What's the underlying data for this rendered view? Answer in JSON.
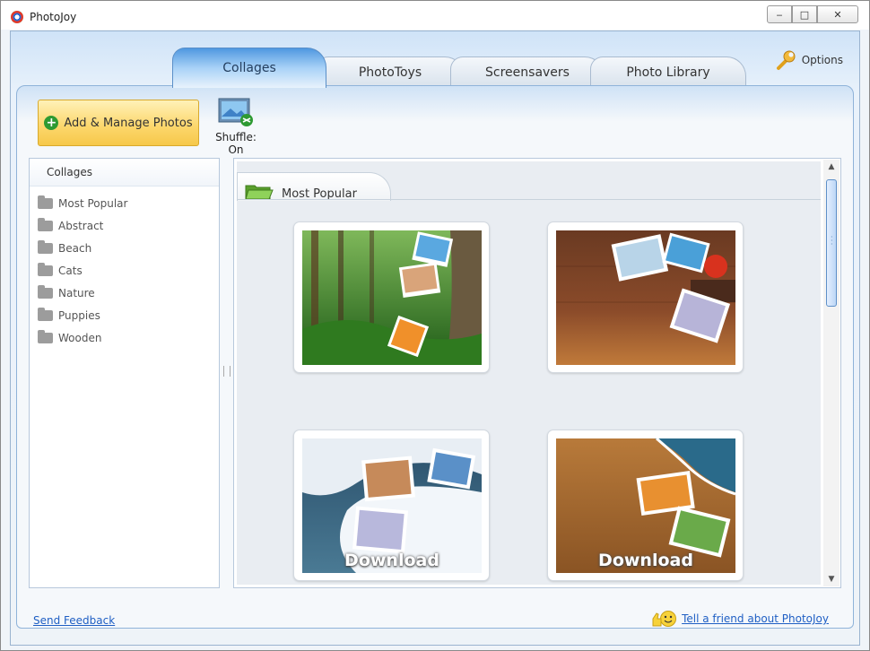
{
  "window": {
    "title": "PhotoJoy",
    "controls": {
      "minimize": "‒",
      "maximize": "□",
      "close": "✕"
    }
  },
  "tabs": [
    {
      "label": "Collages",
      "active": true
    },
    {
      "label": "PhotoToys",
      "active": false
    },
    {
      "label": "Screensavers",
      "active": false
    },
    {
      "label": "Photo Library",
      "active": false
    }
  ],
  "options": {
    "label": "Options",
    "icon": "wrench-icon"
  },
  "toolbar": {
    "add_button": {
      "label": "Add & Manage Photos",
      "icon": "plus-icon"
    },
    "shuffle": {
      "label": "Shuffle: On",
      "icon": "shuffle-icon"
    }
  },
  "sidebar": {
    "header": "Collages",
    "items": [
      {
        "label": "Most Popular"
      },
      {
        "label": "Abstract"
      },
      {
        "label": "Beach"
      },
      {
        "label": "Cats"
      },
      {
        "label": "Nature"
      },
      {
        "label": "Puppies"
      },
      {
        "label": "Wooden"
      }
    ]
  },
  "main": {
    "section_title": "Most Popular",
    "cards": [
      {
        "name": "forest-collage",
        "overlay": ""
      },
      {
        "name": "wooden-collage",
        "overlay": ""
      },
      {
        "name": "snow-collage",
        "overlay": "Download"
      },
      {
        "name": "beach-collage",
        "overlay": "Download"
      }
    ]
  },
  "footer": {
    "feedback": "Send Feedback",
    "tell_friend": "Tell a friend about PhotoJoy"
  },
  "colors": {
    "accent": "#4f98e0",
    "button": "#fcd66a",
    "link": "#1f5fc4"
  }
}
